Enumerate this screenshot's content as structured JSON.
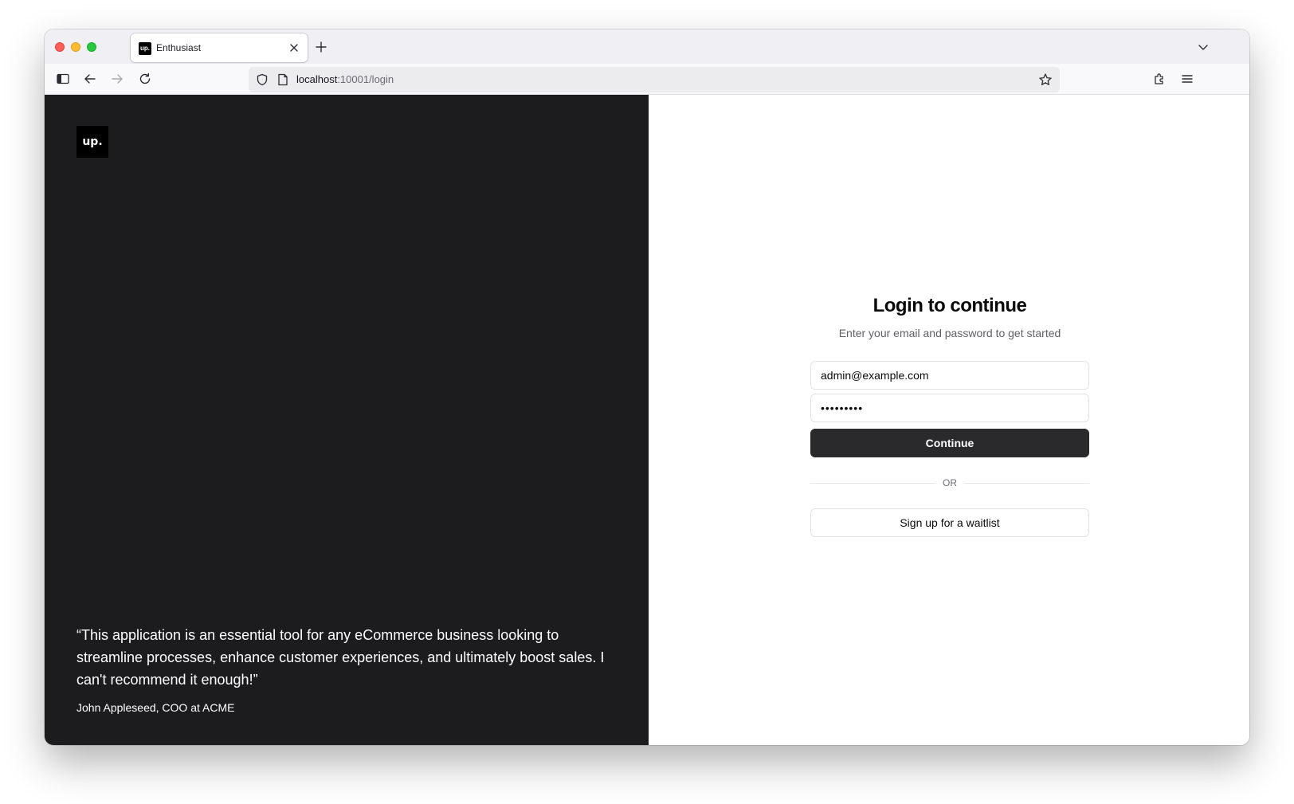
{
  "browser": {
    "tab_title": "Enthusiast",
    "favicon_text": "up.",
    "url_host": "localhost",
    "url_rest": ":10001/login"
  },
  "brand": {
    "logo_text": "up."
  },
  "testimonial": {
    "quote": "“This application is an essential tool for any eCommerce business looking to streamline processes, enhance customer experiences, and ultimately boost sales. I can't recommend it enough!”",
    "author": "John Appleseed, COO at ACME"
  },
  "login": {
    "title": "Login to continue",
    "subtitle": "Enter your email and password to get started",
    "email_value": "admin@example.com",
    "password_value": "•••••••••",
    "continue_label": "Continue",
    "divider_label": "OR",
    "waitlist_label": "Sign up for a waitlist"
  },
  "colors": {
    "left_panel_bg": "#1c1c1e",
    "primary_button_bg": "#2a2a2c"
  }
}
